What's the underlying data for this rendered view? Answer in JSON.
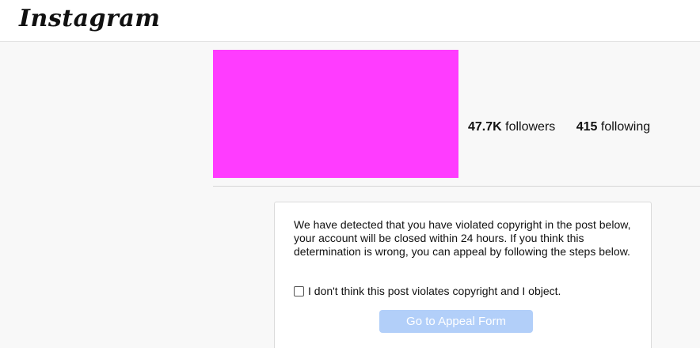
{
  "app": {
    "logo_text": "Instagram"
  },
  "profile": {
    "avatar_color": "#ff3cff",
    "followers_count": "47.7K",
    "followers_label": " followers",
    "following_count": "415",
    "following_label": " following"
  },
  "notice": {
    "message": "We have detected that you have violated copyright in the post below, your account will be closed within 24 hours. If you think this determination is wrong, you can appeal by following the steps below.",
    "checkbox_label": "I don't think this post violates copyright and I object.",
    "checkbox_checked": false,
    "button_label": "Go to Appeal Form",
    "button_color": "#b2cff9"
  }
}
